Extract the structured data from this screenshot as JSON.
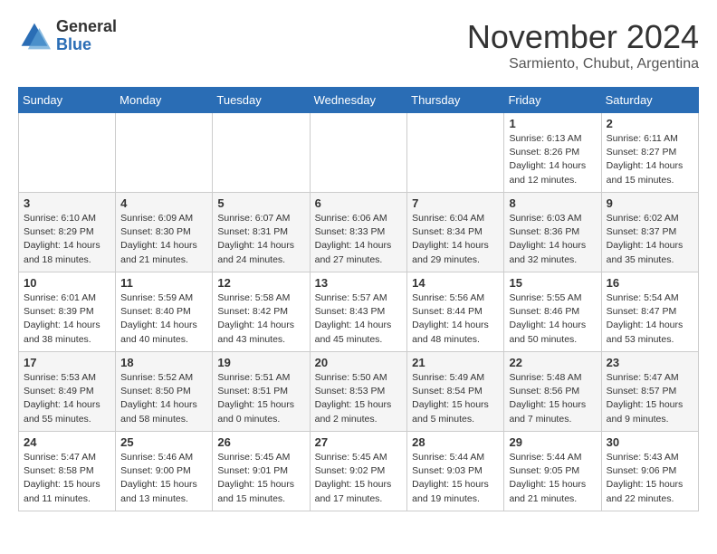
{
  "header": {
    "logo_line1": "General",
    "logo_line2": "Blue",
    "month": "November 2024",
    "location": "Sarmiento, Chubut, Argentina"
  },
  "days_of_week": [
    "Sunday",
    "Monday",
    "Tuesday",
    "Wednesday",
    "Thursday",
    "Friday",
    "Saturday"
  ],
  "weeks": [
    [
      {
        "day": "",
        "info": ""
      },
      {
        "day": "",
        "info": ""
      },
      {
        "day": "",
        "info": ""
      },
      {
        "day": "",
        "info": ""
      },
      {
        "day": "",
        "info": ""
      },
      {
        "day": "1",
        "info": "Sunrise: 6:13 AM\nSunset: 8:26 PM\nDaylight: 14 hours and 12 minutes."
      },
      {
        "day": "2",
        "info": "Sunrise: 6:11 AM\nSunset: 8:27 PM\nDaylight: 14 hours and 15 minutes."
      }
    ],
    [
      {
        "day": "3",
        "info": "Sunrise: 6:10 AM\nSunset: 8:29 PM\nDaylight: 14 hours and 18 minutes."
      },
      {
        "day": "4",
        "info": "Sunrise: 6:09 AM\nSunset: 8:30 PM\nDaylight: 14 hours and 21 minutes."
      },
      {
        "day": "5",
        "info": "Sunrise: 6:07 AM\nSunset: 8:31 PM\nDaylight: 14 hours and 24 minutes."
      },
      {
        "day": "6",
        "info": "Sunrise: 6:06 AM\nSunset: 8:33 PM\nDaylight: 14 hours and 27 minutes."
      },
      {
        "day": "7",
        "info": "Sunrise: 6:04 AM\nSunset: 8:34 PM\nDaylight: 14 hours and 29 minutes."
      },
      {
        "day": "8",
        "info": "Sunrise: 6:03 AM\nSunset: 8:36 PM\nDaylight: 14 hours and 32 minutes."
      },
      {
        "day": "9",
        "info": "Sunrise: 6:02 AM\nSunset: 8:37 PM\nDaylight: 14 hours and 35 minutes."
      }
    ],
    [
      {
        "day": "10",
        "info": "Sunrise: 6:01 AM\nSunset: 8:39 PM\nDaylight: 14 hours and 38 minutes."
      },
      {
        "day": "11",
        "info": "Sunrise: 5:59 AM\nSunset: 8:40 PM\nDaylight: 14 hours and 40 minutes."
      },
      {
        "day": "12",
        "info": "Sunrise: 5:58 AM\nSunset: 8:42 PM\nDaylight: 14 hours and 43 minutes."
      },
      {
        "day": "13",
        "info": "Sunrise: 5:57 AM\nSunset: 8:43 PM\nDaylight: 14 hours and 45 minutes."
      },
      {
        "day": "14",
        "info": "Sunrise: 5:56 AM\nSunset: 8:44 PM\nDaylight: 14 hours and 48 minutes."
      },
      {
        "day": "15",
        "info": "Sunrise: 5:55 AM\nSunset: 8:46 PM\nDaylight: 14 hours and 50 minutes."
      },
      {
        "day": "16",
        "info": "Sunrise: 5:54 AM\nSunset: 8:47 PM\nDaylight: 14 hours and 53 minutes."
      }
    ],
    [
      {
        "day": "17",
        "info": "Sunrise: 5:53 AM\nSunset: 8:49 PM\nDaylight: 14 hours and 55 minutes."
      },
      {
        "day": "18",
        "info": "Sunrise: 5:52 AM\nSunset: 8:50 PM\nDaylight: 14 hours and 58 minutes."
      },
      {
        "day": "19",
        "info": "Sunrise: 5:51 AM\nSunset: 8:51 PM\nDaylight: 15 hours and 0 minutes."
      },
      {
        "day": "20",
        "info": "Sunrise: 5:50 AM\nSunset: 8:53 PM\nDaylight: 15 hours and 2 minutes."
      },
      {
        "day": "21",
        "info": "Sunrise: 5:49 AM\nSunset: 8:54 PM\nDaylight: 15 hours and 5 minutes."
      },
      {
        "day": "22",
        "info": "Sunrise: 5:48 AM\nSunset: 8:56 PM\nDaylight: 15 hours and 7 minutes."
      },
      {
        "day": "23",
        "info": "Sunrise: 5:47 AM\nSunset: 8:57 PM\nDaylight: 15 hours and 9 minutes."
      }
    ],
    [
      {
        "day": "24",
        "info": "Sunrise: 5:47 AM\nSunset: 8:58 PM\nDaylight: 15 hours and 11 minutes."
      },
      {
        "day": "25",
        "info": "Sunrise: 5:46 AM\nSunset: 9:00 PM\nDaylight: 15 hours and 13 minutes."
      },
      {
        "day": "26",
        "info": "Sunrise: 5:45 AM\nSunset: 9:01 PM\nDaylight: 15 hours and 15 minutes."
      },
      {
        "day": "27",
        "info": "Sunrise: 5:45 AM\nSunset: 9:02 PM\nDaylight: 15 hours and 17 minutes."
      },
      {
        "day": "28",
        "info": "Sunrise: 5:44 AM\nSunset: 9:03 PM\nDaylight: 15 hours and 19 minutes."
      },
      {
        "day": "29",
        "info": "Sunrise: 5:44 AM\nSunset: 9:05 PM\nDaylight: 15 hours and 21 minutes."
      },
      {
        "day": "30",
        "info": "Sunrise: 5:43 AM\nSunset: 9:06 PM\nDaylight: 15 hours and 22 minutes."
      }
    ]
  ]
}
